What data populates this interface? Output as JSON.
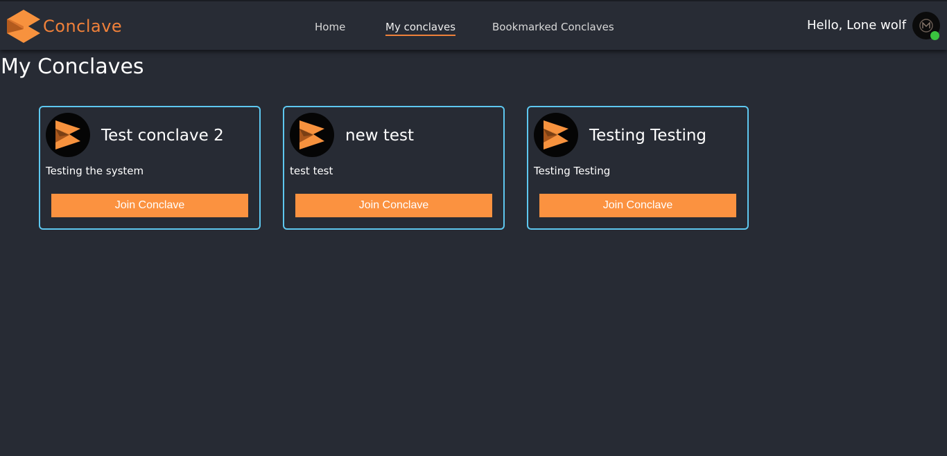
{
  "brand": {
    "name": "Conclave",
    "logo_icon": "conclave-logo-icon",
    "accent_color": "#f0813a"
  },
  "nav": {
    "items": [
      {
        "label": "Home",
        "active": false
      },
      {
        "label": "My conclaves",
        "active": true
      },
      {
        "label": "Bookmarked Conclaves",
        "active": false
      }
    ]
  },
  "user": {
    "greeting": "Hello, Lone wolf",
    "avatar_icon": "user-avatar-icon",
    "online": true,
    "status_color": "#3ac43f"
  },
  "page": {
    "title": "My Conclaves"
  },
  "conclaves": [
    {
      "title": "Test conclave 2",
      "description": "Testing the system",
      "button_label": "Join Conclave"
    },
    {
      "title": "new test",
      "description": "test test",
      "button_label": "Join Conclave"
    },
    {
      "title": "Testing Testing",
      "description": "Testing Testing",
      "button_label": "Join Conclave"
    }
  ],
  "colors": {
    "background": "#272b34",
    "card_border": "#5ec8f0",
    "button": "#fb9240"
  }
}
